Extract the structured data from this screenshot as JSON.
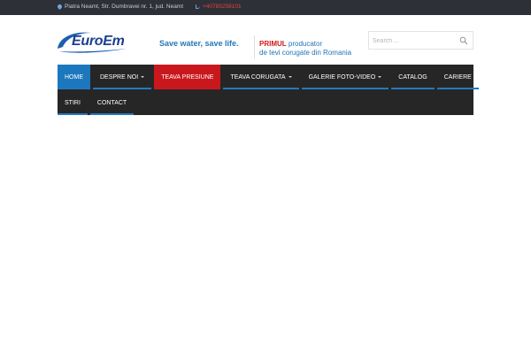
{
  "topbar": {
    "address": "Piatra Neamt, Str. Dumbravei nr. 1, jud. Neamt",
    "phone": "+40785258101",
    "address_icon": "map-pin-icon",
    "phone_icon": "phone-icon"
  },
  "header": {
    "logo_text": "EuroEm",
    "tagline": "Save water, save life.",
    "claim_strong": "PRIMUL",
    "claim_rest": " producator",
    "claim_line2": "de tevi corugate din Romania"
  },
  "search": {
    "placeholder": "Search ...",
    "icon": "search-icon"
  },
  "nav": {
    "row1": [
      {
        "label": "HOME",
        "style": "active",
        "caret": false
      },
      {
        "label": "DESPRE NOI",
        "style": "normal",
        "caret": true
      },
      {
        "label": "TEAVA PRESIUNE",
        "style": "red",
        "caret": false
      },
      {
        "label": "TEAVA CORUGATA",
        "style": "normal",
        "caret": true
      },
      {
        "label": "GALERIE FOTO-VIDEO",
        "style": "normal",
        "caret": true
      },
      {
        "label": "CATALOG",
        "style": "normal",
        "caret": false
      },
      {
        "label": "CARIERE",
        "style": "normal",
        "caret": false
      }
    ],
    "row2": [
      {
        "label": "STIRI",
        "style": "normal",
        "caret": false
      },
      {
        "label": "CONTACT",
        "style": "normal",
        "caret": false
      }
    ]
  },
  "colors": {
    "topbar_bg": "#2e3037",
    "accent_blue": "#1c78bd",
    "accent_red": "#c9171e",
    "nav_bg": "#262626"
  }
}
